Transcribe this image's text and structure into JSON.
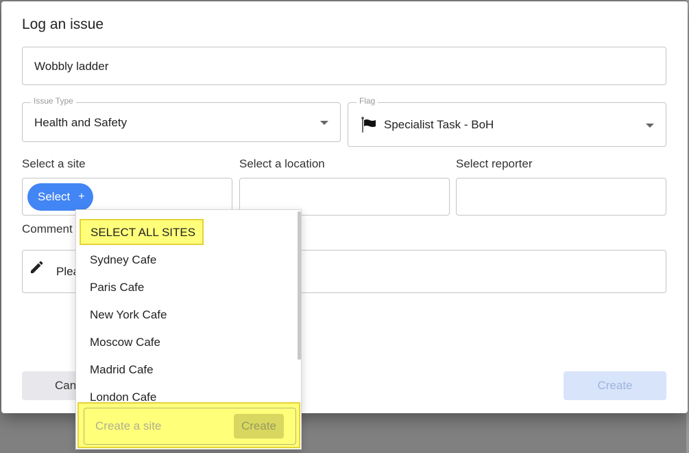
{
  "dialog": {
    "title": "Log an issue",
    "issue_title_value": "Wobbly ladder",
    "issue_type": {
      "legend": "Issue Type",
      "value": "Health and Safety"
    },
    "flag": {
      "legend": "Flag",
      "value": "Specialist Task - BoH",
      "icon": "flag-icon"
    },
    "site_label": "Select a site",
    "location_label": "Select a location",
    "reporter_label": "Select reporter",
    "site_chip": {
      "label": "Select",
      "icon": "+"
    },
    "comment_label": "Comment",
    "comment_placeholder": "Plea",
    "cancel_label": "Can",
    "create_label": "Create"
  },
  "dropdown": {
    "select_all_label": "SELECT ALL SITES",
    "items": [
      "Sydney Cafe",
      "Paris Cafe",
      "New York Cafe",
      "Moscow Cafe",
      "Madrid Cafe",
      "London Cafe"
    ],
    "create_placeholder": "Create a site",
    "create_button_label": "Create"
  },
  "colors": {
    "accent": "#4285f4",
    "highlight": "#ffff7a",
    "create_disabled": "#d8e4fa"
  }
}
